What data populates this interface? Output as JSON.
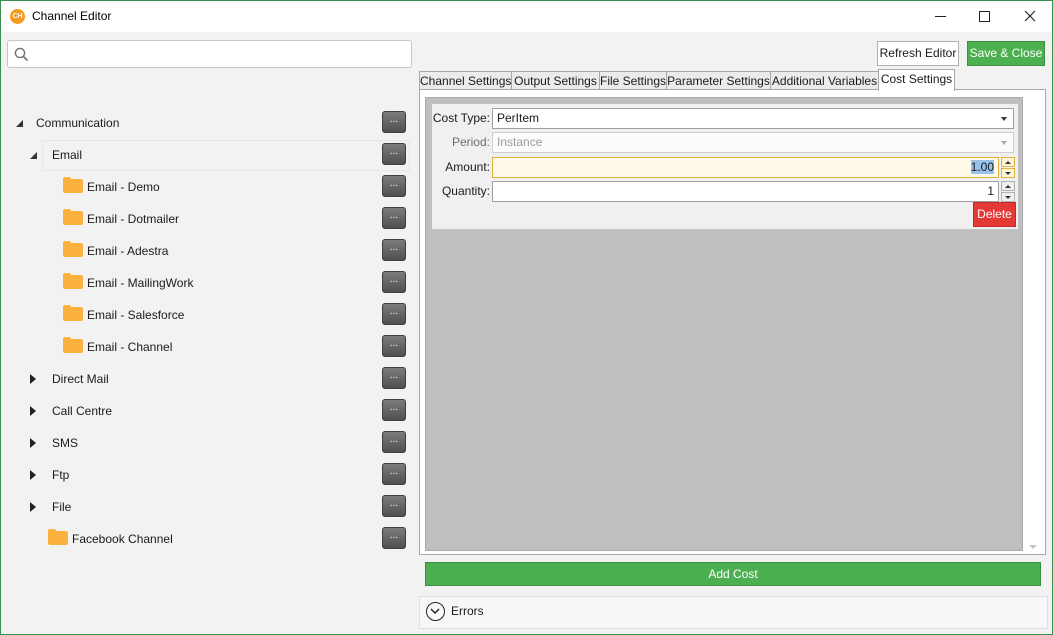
{
  "window": {
    "title": "Channel Editor",
    "app_icon_text": "CH",
    "icons": [
      "app-icon",
      "minimize-icon",
      "maximize-icon",
      "close-icon"
    ]
  },
  "search": {
    "placeholder": "",
    "value": ""
  },
  "toolbar": {
    "refresh_label": "Refresh Editor",
    "save_close_label": "Save & Close"
  },
  "tree": [
    {
      "label": "Communication",
      "expander": "open",
      "folder": false
    },
    {
      "label": "Email",
      "expander": "open",
      "folder": false,
      "selected": true
    },
    {
      "label": "Email - Demo",
      "expander": "none",
      "folder": true
    },
    {
      "label": "Email - Dotmailer",
      "expander": "none",
      "folder": true
    },
    {
      "label": "Email - Adestra",
      "expander": "none",
      "folder": true
    },
    {
      "label": "Email - MailingWork",
      "expander": "none",
      "folder": true
    },
    {
      "label": "Email - Salesforce",
      "expander": "none",
      "folder": true
    },
    {
      "label": "Email - Channel",
      "expander": "none",
      "folder": true
    },
    {
      "label": "Direct Mail",
      "expander": "closed",
      "folder": false
    },
    {
      "label": "Call Centre",
      "expander": "closed",
      "folder": false
    },
    {
      "label": "SMS",
      "expander": "closed",
      "folder": false
    },
    {
      "label": "Ftp",
      "expander": "closed",
      "folder": false
    },
    {
      "label": "File",
      "expander": "closed",
      "folder": false
    },
    {
      "label": "Facebook Channel",
      "expander": "none",
      "folder": true
    }
  ],
  "row_button_label": "...",
  "tabs": [
    {
      "label": "Channel Settings",
      "active": false
    },
    {
      "label": "Output Settings",
      "active": false
    },
    {
      "label": "File Settings",
      "active": false
    },
    {
      "label": "Parameter Settings",
      "active": false
    },
    {
      "label": "Additional Variables",
      "active": false
    },
    {
      "label": "Cost Settings",
      "active": true
    }
  ],
  "cost": {
    "cost_type_label": "Cost Type:",
    "cost_type_value": "PerItem",
    "period_label": "Period:",
    "period_value": "Instance",
    "amount_label": "Amount:",
    "amount_value": "1.00",
    "quantity_label": "Quantity:",
    "quantity_value": "1",
    "delete_label": "Delete"
  },
  "add_cost_label": "Add Cost",
  "errors_label": "Errors",
  "colors": {
    "accent_green": "#4caf50",
    "delete_red": "#e53935",
    "folder_orange": "#fbb040",
    "panel_gray": "#bdbfc1"
  }
}
